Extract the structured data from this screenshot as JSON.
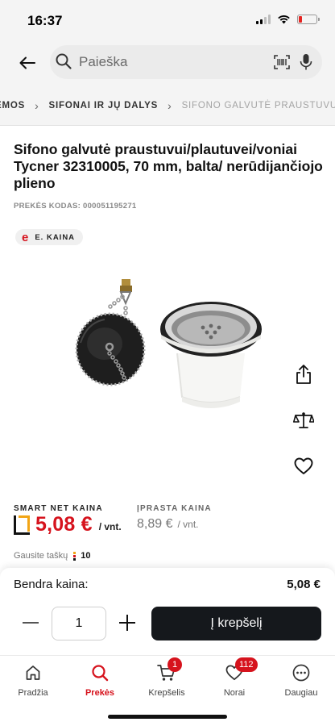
{
  "status_bar": {
    "time": "16:37"
  },
  "search": {
    "placeholder": "Paieška"
  },
  "breadcrumb": {
    "items": [
      "EMOS",
      "SIFONAI IR JŲ DALYS",
      "SIFONO GALVUTĖ PRAUSTUVU..."
    ]
  },
  "product": {
    "title": "Sifono galvutė praustuvui/plautuvei/voniai Tycner 32310005, 70 mm, balta/ nerūdijančiojo plieno",
    "code": "PREKĖS KODAS: 000051195271",
    "e_badge": {
      "symbol": "e",
      "label": "E. KAINA"
    }
  },
  "pricing": {
    "smart_label": "SMART NET KAINA",
    "smart_price": "5,08 €",
    "smart_unit": "/ vnt.",
    "regular_label": "ĮPRASTA KAINA",
    "regular_price": "8,89 €",
    "regular_unit": "/ vnt.",
    "points_label": "Gausite taškų",
    "points_value": "10"
  },
  "cart_panel": {
    "total_label": "Bendra kaina:",
    "total_value": "5,08 €",
    "quantity": "1",
    "add_to_cart_label": "Į krepšelį"
  },
  "tabbar": {
    "items": [
      {
        "label": "Pradžia",
        "icon": "home-icon"
      },
      {
        "label": "Prekės",
        "icon": "search-icon"
      },
      {
        "label": "Krepšelis",
        "icon": "cart-icon",
        "badge": "1"
      },
      {
        "label": "Norai",
        "icon": "heart-icon",
        "badge": "112"
      },
      {
        "label": "Daugiau",
        "icon": "more-icon"
      }
    ]
  },
  "colors": {
    "accent": "#d6131d",
    "dark_button": "#15181c",
    "smart_yellow": "#f2a516"
  }
}
